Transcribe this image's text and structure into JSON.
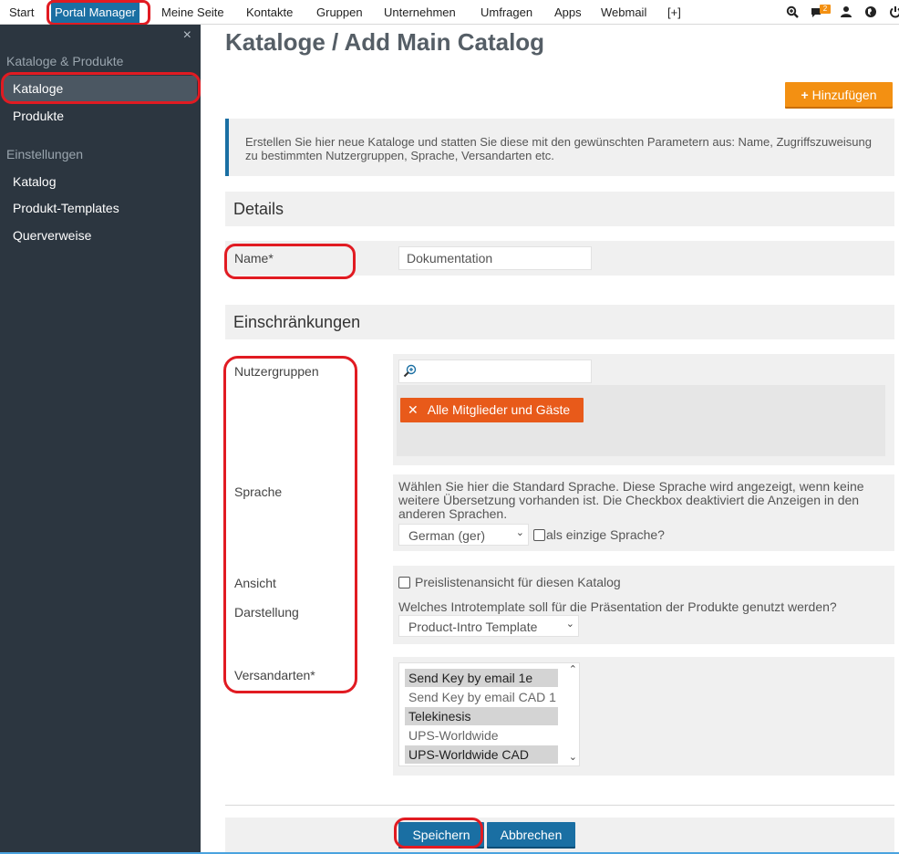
{
  "topnav": {
    "items": [
      "Start",
      "Portal Manager",
      "Meine Seite",
      "Kontakte",
      "Gruppen",
      "Unternehmen",
      "Umfragen",
      "Apps",
      "Webmail",
      "[+]"
    ],
    "notification_count": "2",
    "icons": [
      "zoom-in-icon",
      "chat-icon",
      "user-icon",
      "globe-icon",
      "power-icon"
    ]
  },
  "sidebar": {
    "close_symbol": "×",
    "section1": "Kataloge & Produkte",
    "items1": [
      "Kataloge",
      "Produkte"
    ],
    "section2": "Einstellungen",
    "items2": [
      "Katalog",
      "Produkt-Templates",
      "Querverweise"
    ]
  },
  "page": {
    "title": "Kataloge / Add Main Catalog",
    "add_button": "Hinzufügen",
    "info_text": "Erstellen Sie hier neue Kataloge und statten Sie diese mit den gewünschten Parametern aus: Name, Zugriffszuweisung zu bestimmten Nutzergruppen, Sprache, Versandarten etc."
  },
  "details": {
    "heading": "Details",
    "name_label": "Name*",
    "name_value": "Dokumentation"
  },
  "restrictions": {
    "heading": "Einschränkungen",
    "usergroups_label": "Nutzergruppen",
    "usergroup_tag": "Alle Mitglieder und Gäste",
    "language_label": "Sprache",
    "language_desc": "Wählen Sie hier die Standard Sprache. Diese Sprache wird angezeigt, wenn keine weitere Übersetzung vorhanden ist. Die Checkbox deaktiviert die Anzeigen in den anderen Sprachen.",
    "language_value": "German (ger)",
    "only_language_label": "als einzige Sprache?",
    "view_label": "Ansicht",
    "price_list_label": "Preislistenansicht für diesen Katalog",
    "display_label": "Darstellung",
    "display_desc": "Welches Introtemplate soll für die Präsentation der Produkte genutzt werden?",
    "template_value": "Product-Intro Template",
    "shipping_label": "Versandarten*",
    "shipping_options": [
      {
        "label": "Send Key by email 1e",
        "selected": true
      },
      {
        "label": "Send Key by email CAD 1",
        "selected": false
      },
      {
        "label": "Telekinesis",
        "selected": true
      },
      {
        "label": "UPS-Worldwide",
        "selected": false
      },
      {
        "label": "UPS-Worldwide CAD",
        "selected": true
      }
    ]
  },
  "footer": {
    "save": "Speichern",
    "cancel": "Abbrechen"
  }
}
